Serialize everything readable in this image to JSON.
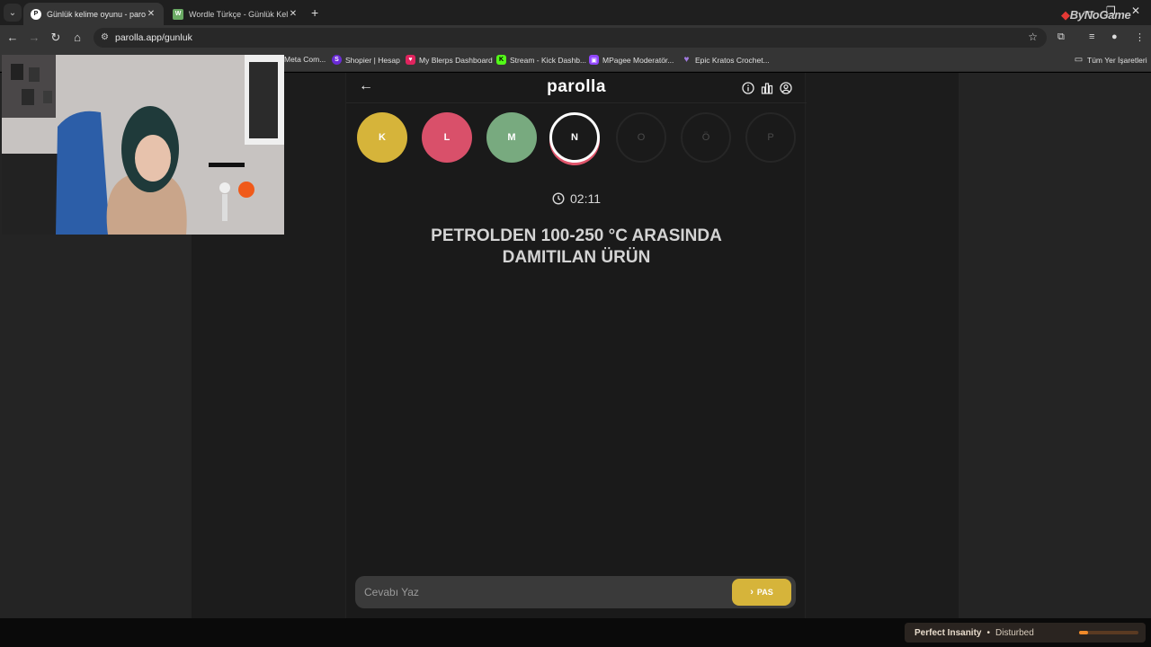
{
  "browser": {
    "tabs": [
      {
        "title": "Günlük kelime oyunu - parolla",
        "active": true
      },
      {
        "title": "Wordle Türkçe - Günlük Kelime",
        "active": false
      }
    ],
    "url": "parolla.app/gunluk",
    "bookmarks": [
      {
        "label": "Meta Com..."
      },
      {
        "label": "Shopier | Hesap"
      },
      {
        "label": "My Blerps Dashboard"
      },
      {
        "label": "Stream - Kick Dashb..."
      },
      {
        "label": "MPagee Moderatör..."
      },
      {
        "label": "Epic Kratos Crochet..."
      }
    ],
    "all_bookmarks": "Tüm Yer İşaretleri",
    "watermark": "ByNoGame"
  },
  "app": {
    "logo": "parolla",
    "letters": [
      {
        "char": "K",
        "state": "correct",
        "color": "#d6b43a"
      },
      {
        "char": "L",
        "state": "wrong",
        "color": "#d9506a"
      },
      {
        "char": "M",
        "state": "correct-green",
        "color": "#78aa7f"
      },
      {
        "char": "N",
        "state": "current"
      },
      {
        "char": "O",
        "state": "pending"
      },
      {
        "char": "Ö",
        "state": "pending"
      },
      {
        "char": "P",
        "state": "pending"
      }
    ],
    "timer": "02:11",
    "question_line1": "PETROLDEN 100-250 °C ARASINDA",
    "question_line2": "DAMITILAN ÜRÜN",
    "answer_placeholder": "Cevabı Yaz",
    "pass_label": "PAS"
  },
  "now_playing": {
    "song": "Perfect Insanity",
    "artist": "Disturbed",
    "progress": 0.15
  },
  "colors": {
    "accent_yellow": "#d6b43a",
    "accent_red": "#d9506a",
    "accent_green": "#78aa7f"
  }
}
